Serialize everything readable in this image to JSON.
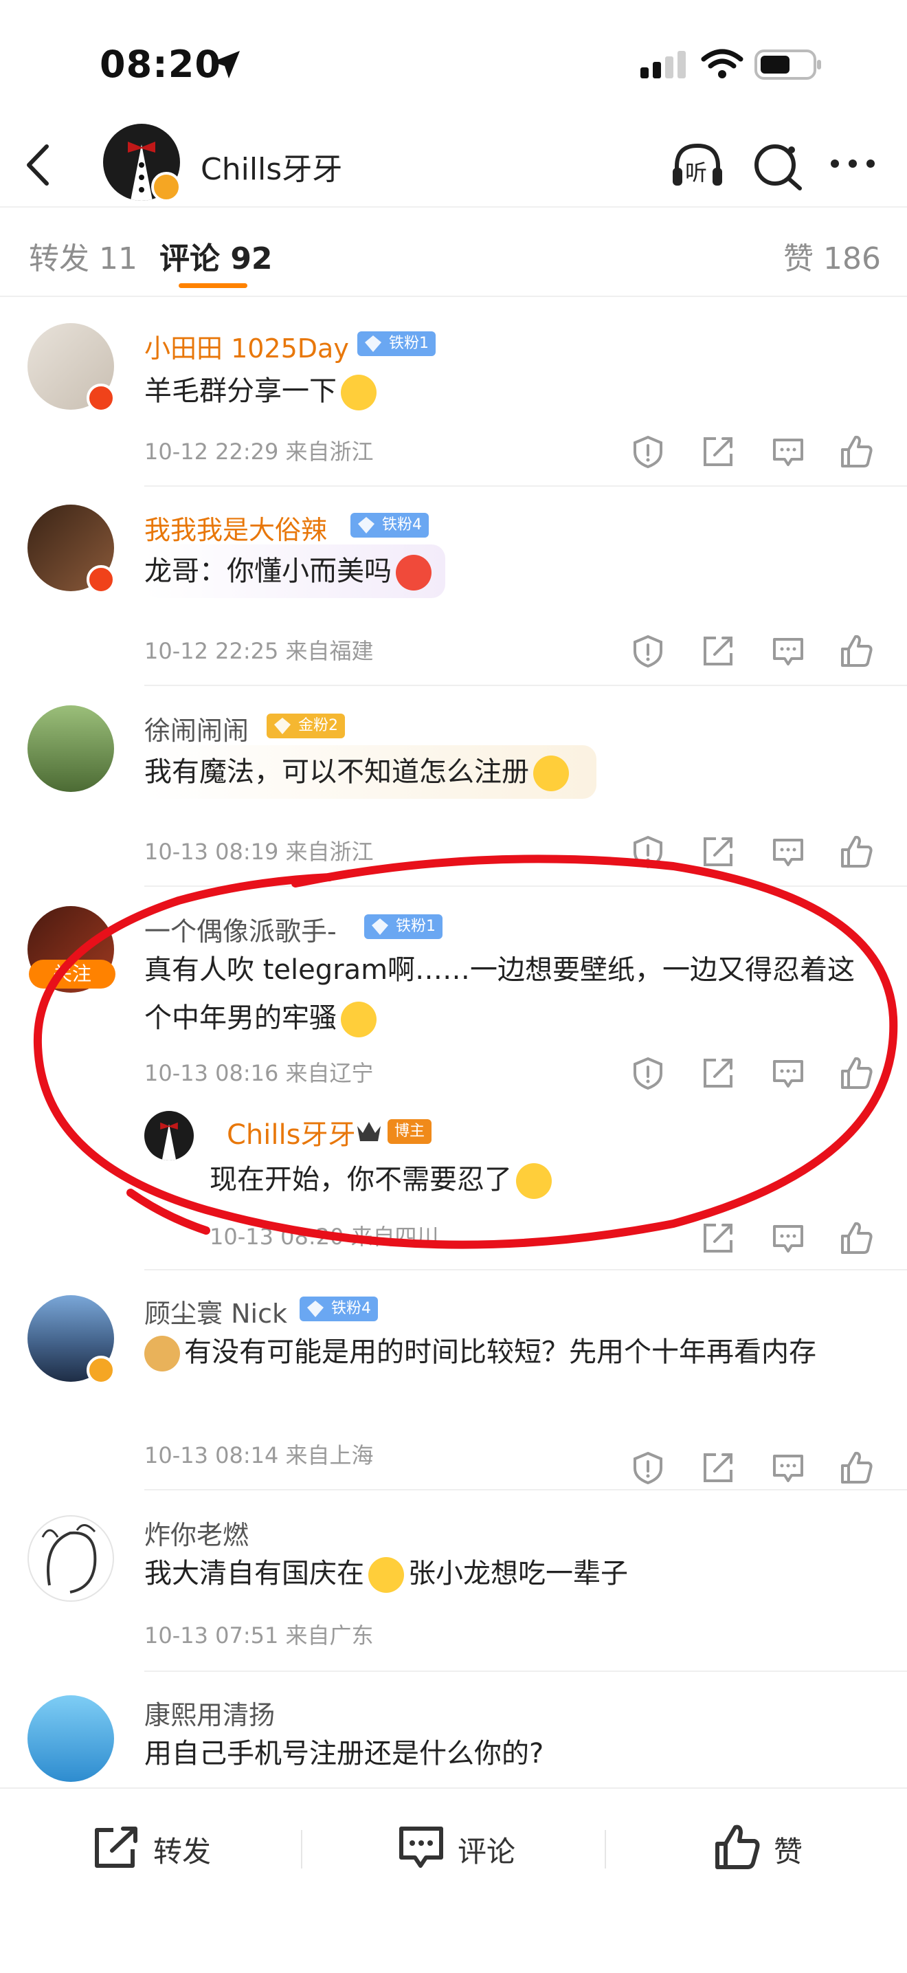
{
  "status": {
    "time": "08:20"
  },
  "header": {
    "name": "Chills牙牙",
    "listen_label": "听"
  },
  "tabs": {
    "repost": "转发 11",
    "comment": "评论 92",
    "like": "赞 186"
  },
  "comments": [
    {
      "name": "小田田 1025Day",
      "badge": "铁粉1",
      "text": "羊毛群分享一下",
      "meta": "10-12 22:29 来自浙江"
    },
    {
      "name": "我我我是大俗辣",
      "badge": "铁粉4",
      "text": "龙哥：你懂小而美吗",
      "meta": "10-12 22:25 来自福建"
    },
    {
      "name": "徐闹闹闹",
      "badge": "金粉2",
      "text": "我有魔法，可以不知道怎么注册",
      "meta": "10-13 08:19 来自浙江"
    },
    {
      "name": "一个偶像派歌手-",
      "badge": "铁粉1",
      "follow": "关注",
      "text": "真有人吹 telegram啊……一边想要壁纸，一边又得忍着这个中年男的牢骚",
      "meta": "10-13 08:16 来自辽宁",
      "reply": {
        "name": "Chills牙牙",
        "badge": "博主",
        "text": "现在开始，你不需要忍了",
        "meta": "10-13 08:20 来自四川"
      }
    },
    {
      "name": "顾尘寰 Nick",
      "badge": "铁粉4",
      "text": "有没有可能是用的时间比较短？先用个十年再看内存",
      "meta": "10-13 08:14 来自上海"
    },
    {
      "name": "炸你老燃",
      "text": "我大清自有国庆在",
      "text2": "张小龙想吃一辈子",
      "meta": "10-13 07:51 来自广东"
    },
    {
      "name": "康熙用清扬",
      "text": "用自己手机号注册还是什么你的?"
    }
  ],
  "bottom": {
    "repost": "转发",
    "comment": "评论",
    "like": "赞"
  },
  "colors": {
    "accent": "#ff8200",
    "annotation": "#e8101a",
    "name_orange": "#e8770a",
    "iron_badge": "#6aa7f2",
    "gold_badge": "#f5b731"
  }
}
